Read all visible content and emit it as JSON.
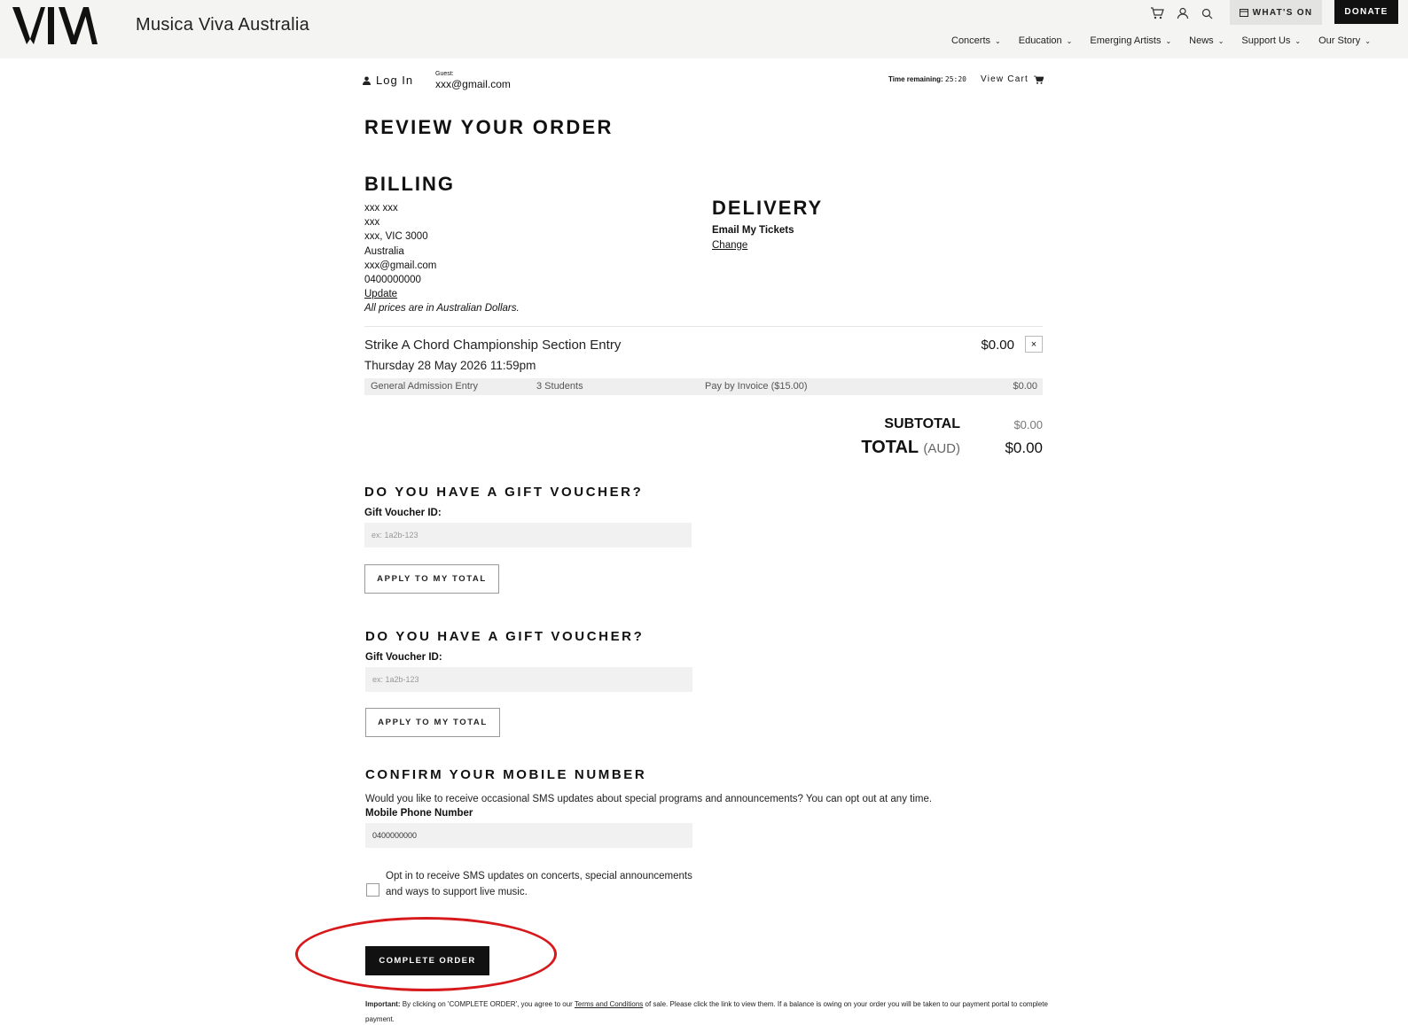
{
  "header": {
    "brand": "Musica Viva Australia",
    "whats_on": "WHAT'S ON",
    "donate": "DONATE",
    "nav": [
      "Concerts",
      "Education",
      "Emerging Artists",
      "News",
      "Support Us",
      "Our Story"
    ],
    "icons": [
      "cart-icon",
      "user-icon",
      "search-icon",
      "calendar-icon"
    ]
  },
  "account": {
    "login": "Log In",
    "guest_label": "Guest:",
    "guest_email": "xxx@gmail.com",
    "time_label": "Time remaining:",
    "time_value": "25:20",
    "view_cart": "View Cart"
  },
  "page_title": "REVIEW YOUR ORDER",
  "billing": {
    "heading": "BILLING",
    "name": "xxx xxx",
    "line1": "xxx",
    "city": "xxx, VIC 3000",
    "country": "Australia",
    "email": "xxx@gmail.com",
    "phone": "0400000000",
    "update": "Update",
    "note": "All prices are in Australian Dollars."
  },
  "delivery": {
    "heading": "DELIVERY",
    "method": "Email My Tickets",
    "change": "Change"
  },
  "order_item": {
    "name": "Strike A Chord Championship Section Entry",
    "date": "Thursday 28 May 2026 11:59pm",
    "price": "$0.00",
    "remove": "×",
    "line": {
      "type": "General Admission Entry",
      "qty": "3 Students",
      "payment": "Pay by Invoice ($15.00)",
      "amount": "$0.00"
    }
  },
  "totals": {
    "subtotal_label": "SUBTOTAL",
    "subtotal_value": "$0.00",
    "total_label": "TOTAL",
    "total_currency": "(AUD)",
    "total_value": "$0.00"
  },
  "voucher1": {
    "heading": "DO YOU HAVE A GIFT VOUCHER?",
    "label": "Gift Voucher ID:",
    "placeholder": "ex: 1a2b-123",
    "button": "APPLY TO MY TOTAL"
  },
  "voucher2": {
    "heading": "DO YOU HAVE A GIFT VOUCHER?",
    "label": "Gift Voucher ID:",
    "placeholder": "ex: 1a2b-123",
    "button": "APPLY TO MY TOTAL"
  },
  "mobile": {
    "heading": "CONFIRM YOUR MOBILE NUMBER",
    "text": "Would you like to receive occasional SMS updates about special programs and announcements? You can opt out at any time.",
    "label": "Mobile Phone Number",
    "value": "0400000000",
    "optin": "Opt in to receive SMS updates on concerts, special announcements and ways to support live music."
  },
  "complete_button": "COMPLETE ORDER",
  "important": {
    "bold": "Important:",
    "pre": " By clicking on 'COMPLETE ORDER', you agree to our ",
    "link": "Terms and Conditions",
    "post": " of sale. Please click the link to view them. If a balance is owing on your order you will be taken to our payment portal to complete payment."
  },
  "colors": {
    "header_bg": "#f4f4f2",
    "dark": "#111111",
    "annotation": "#d7191c"
  }
}
